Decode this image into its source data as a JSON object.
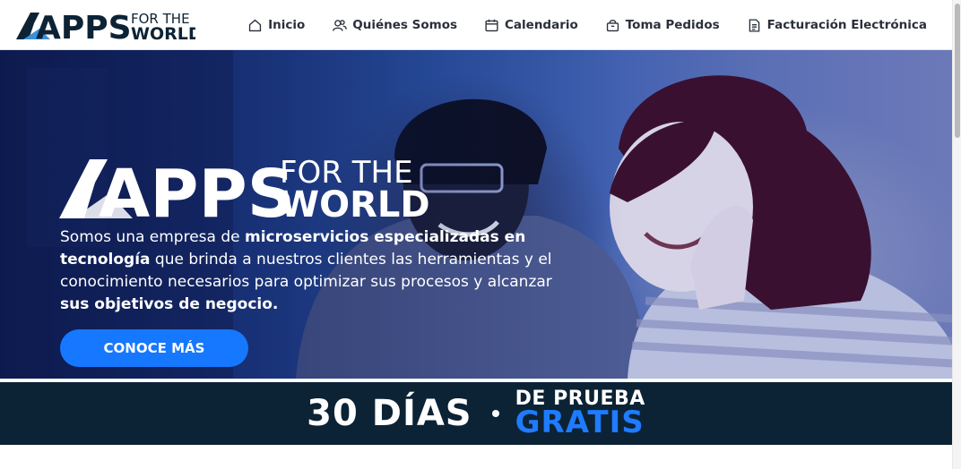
{
  "header": {
    "logo_apps": "APPS",
    "logo_for_the": "FOR THE",
    "logo_world": "WORLD"
  },
  "nav": {
    "items": [
      {
        "label": "Inicio",
        "icon": "home-icon"
      },
      {
        "label": "Quiénes Somos",
        "icon": "users-icon"
      },
      {
        "label": "Calendario",
        "icon": "calendar-icon"
      },
      {
        "label": "Toma Pedidos",
        "icon": "bag-icon"
      },
      {
        "label": "Facturación Electrónica",
        "icon": "document-icon"
      }
    ]
  },
  "hero": {
    "logo_apps": "APPS",
    "logo_for_the": "FOR THE",
    "logo_world": "WORLD",
    "text_1": "Somos una empresa de ",
    "text_2_bold": "microservicios especializadas en tecnología",
    "text_3": " que brinda a nuestros clientes las herramientas y el conocimiento necesarios para optimizar sus procesos y alcanzar ",
    "text_4_bold": "sus objetivos de negocio.",
    "cta_label": "CONOCE MÁS"
  },
  "promo": {
    "days": "30 DÍAS",
    "trial": "DE PRUEBA",
    "free": "GRATIS"
  },
  "colors": {
    "brand_navy": "#0c2335",
    "accent_blue": "#1677ff",
    "promo_blue": "#1f7bff"
  }
}
